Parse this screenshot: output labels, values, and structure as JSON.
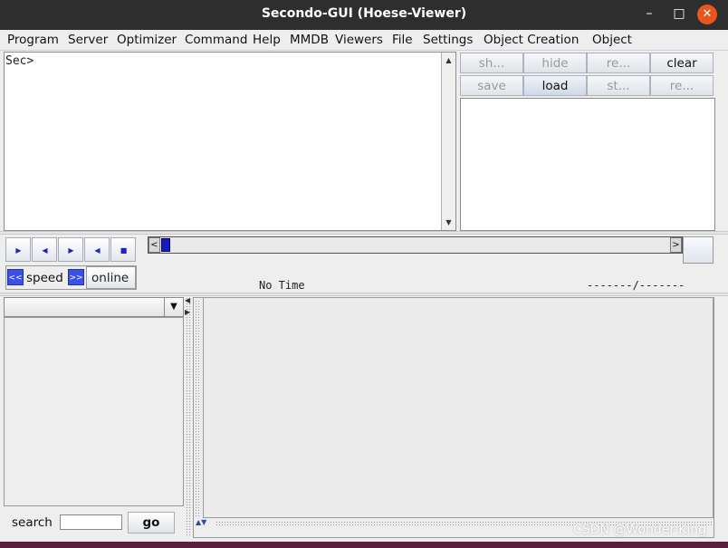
{
  "window": {
    "title": "Secondo-GUI (Hoese-Viewer)",
    "minimize": "–",
    "maximize": "□",
    "close": "✕"
  },
  "menu": [
    "Program",
    "Server",
    "Optimizer",
    "Command",
    "Help",
    "MMDB",
    "Viewers",
    "File",
    "Settings",
    "Object Creation",
    "Object"
  ],
  "console": {
    "prompt": "Sec>"
  },
  "object_buttons": {
    "row1": [
      "sh...",
      "hide",
      "re...",
      "clear"
    ],
    "row2": [
      "save",
      "load",
      "st...",
      "re..."
    ]
  },
  "playback": {
    "icons": [
      "play-forward-icon",
      "step-back-icon",
      "step-forward-icon",
      "skip-to-start-icon",
      "stop-icon"
    ],
    "speed_label": "speed",
    "slower": "<<",
    "faster": ">>",
    "online_label": "online",
    "left_arrow": "<",
    "right_arrow": ">",
    "time_text": "No Time",
    "counter_text": "-------/-------"
  },
  "search": {
    "label": "search",
    "value": "",
    "go_label": "go"
  },
  "watermark": "CSDN @Wonder-King",
  "colors": {
    "titlebar": "#2e2e2e",
    "close_button": "#e9541f",
    "accent_blue": "#3b50e6",
    "slider_thumb": "#1a1ab8"
  }
}
